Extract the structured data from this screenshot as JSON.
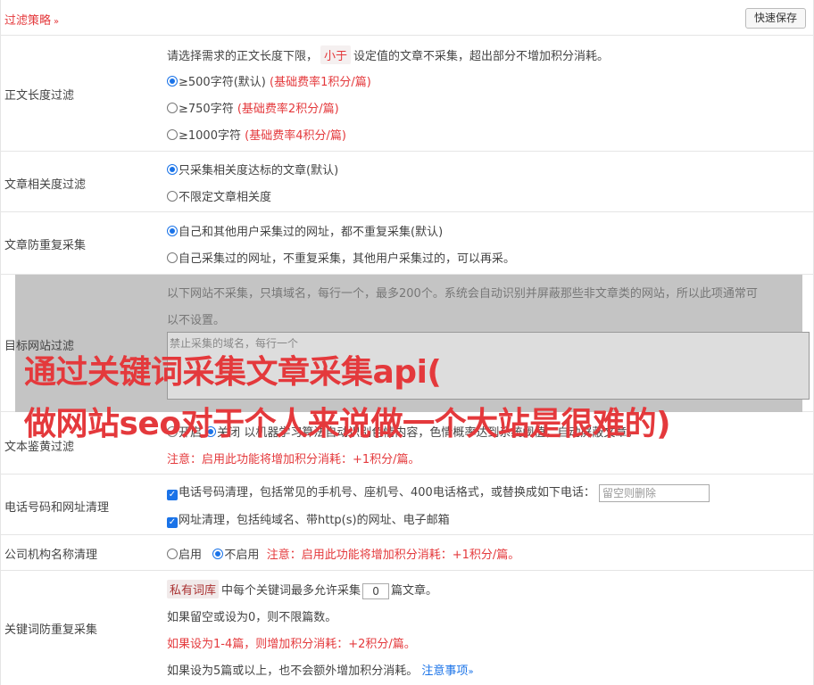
{
  "header": {
    "title": "过滤策略",
    "chevron": "»",
    "save_button": "快速保存"
  },
  "length_filter": {
    "label": "正文长度过滤",
    "desc_before": "请选择需求的正文长度下限，",
    "desc_tag": "小于",
    "desc_after": "设定值的文章不采集，超出部分不增加积分消耗。",
    "options": [
      {
        "text": "≥500字符(默认)",
        "note": "(基础费率1积分/篇)",
        "selected": true
      },
      {
        "text": "≥750字符",
        "note": "(基础费率2积分/篇)",
        "selected": false
      },
      {
        "text": "≥1000字符",
        "note": "(基础费率4积分/篇)",
        "selected": false
      }
    ]
  },
  "relevance_filter": {
    "label": "文章相关度过滤",
    "options": [
      {
        "text": "只采集相关度达标的文章(默认)",
        "selected": true
      },
      {
        "text": "不限定文章相关度",
        "selected": false
      }
    ]
  },
  "dedupe": {
    "label": "文章防重复采集",
    "options": [
      {
        "text": "自己和其他用户采集过的网址，都不重复采集(默认)",
        "selected": true
      },
      {
        "text": "自己采集过的网址，不重复采集，其他用户采集过的，可以再采。",
        "selected": false
      }
    ]
  },
  "target_site": {
    "label": "目标网站过滤",
    "desc_line1": "以下网站不采集，只填域名，每行一个，最多200个。系统会自动识别并屏蔽那些非文章类的网站，所以此项通常可",
    "desc_line2": "以不设置。",
    "placeholder": "禁止采集的域名，每行一个"
  },
  "porn_filter": {
    "label": "文本鉴黄过滤",
    "opt_on": "开启",
    "opt_off": "关闭",
    "desc": "以机器学习算法自动识别色情内容，色情概率达到系统阈值，自动屏蔽文章。",
    "note": "注意：启用此功能将增加积分消耗：+1积分/篇。"
  },
  "phone_url": {
    "label": "电话号码和网址清理",
    "phone_text": "电话号码清理，包括常见的手机号、座机号、400电话格式，或替换成如下电话：",
    "phone_placeholder": "留空则删除",
    "url_text": "网址清理，包括纯域名、带http(s)的网址、电子邮箱"
  },
  "org_name": {
    "label": "公司机构名称清理",
    "opt_on": "启用",
    "opt_off": "不启用",
    "note": "注意：启用此功能将增加积分消耗：+1积分/篇。"
  },
  "keyword_dedupe": {
    "label": "关键词防重复采集",
    "tag": "私有词库",
    "line1_before": "中每个关键词最多允许采集",
    "value": "0",
    "line1_after": "篇文章。",
    "line2": "如果留空或设为0，则不限篇数。",
    "line3": "如果设为1-4篇，则增加积分消耗：+2积分/篇。",
    "line4": "如果设为5篇或以上，也不会额外增加积分消耗。",
    "link": "注意事项",
    "link_chevron": "»"
  },
  "overlay_title": {
    "line1": "通过关键词采集文章采集api(",
    "line2": "做网站seo对于个人来说做一个大站是很难的)"
  }
}
